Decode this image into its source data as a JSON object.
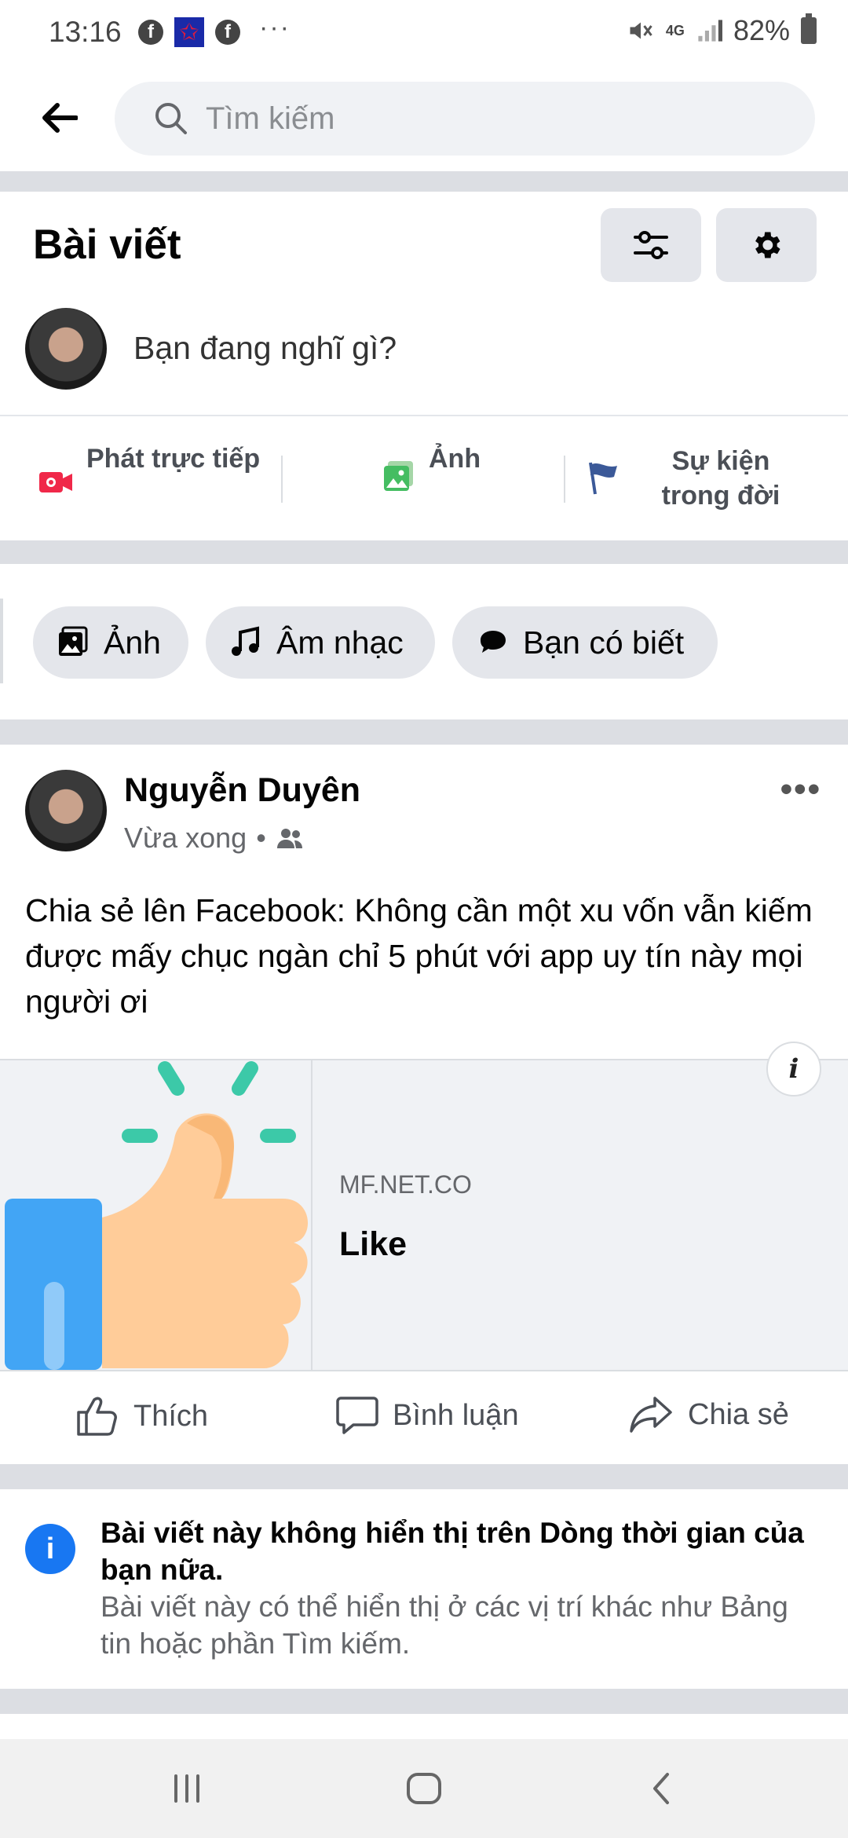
{
  "status_bar": {
    "time": "13:16",
    "network": "4G",
    "battery": "82%",
    "more_dots": "···"
  },
  "search": {
    "placeholder": "Tìm kiếm"
  },
  "section": {
    "title": "Bài viết"
  },
  "composer": {
    "prompt": "Bạn đang nghĩ gì?",
    "actions": [
      {
        "label": "Phát trực tiếp",
        "icon": "live-video-icon",
        "color": "#f02849"
      },
      {
        "label": "Ảnh",
        "icon": "photo-icon",
        "color": "#45bd62"
      },
      {
        "label": "Sự kiện trong đời",
        "icon": "flag-icon",
        "color": "#3b5998"
      }
    ]
  },
  "chips": [
    {
      "label": "Ảnh",
      "icon": "photo-icon"
    },
    {
      "label": "Âm nhạc",
      "icon": "music-note-icon"
    },
    {
      "label": "Bạn có biết",
      "icon": "speech-bubble-icon"
    }
  ],
  "post": {
    "author": "Nguyễn Duyên",
    "time": "Vừa xong",
    "separator": "•",
    "audience_icon": "friends-icon",
    "more": "•••",
    "text": "Chia sẻ lên Facebook: Không cần một xu vốn vẫn kiếm được mấy chục ngàn chỉ 5 phút với app uy tín này mọi người ơi",
    "link": {
      "domain": "MF.NET.CO",
      "title": "Like",
      "info": "i"
    },
    "reactions": [
      {
        "label": "Thích",
        "icon": "thumbs-up-icon"
      },
      {
        "label": "Bình luận",
        "icon": "comment-icon"
      },
      {
        "label": "Chia sẻ",
        "icon": "share-icon"
      }
    ]
  },
  "notice": {
    "icon_text": "i",
    "title": "Bài viết này không hiển thị trên Dòng thời gian của bạn nữa.",
    "body": "Bài viết này có thể hiển thị ở các vị trí khác như Bảng tin hoặc phần Tìm kiếm."
  },
  "colors": {
    "accent": "#1877f2",
    "divider": "#dcdee3",
    "chip_bg": "#e4e6eb",
    "secondary_text": "#65676b"
  }
}
